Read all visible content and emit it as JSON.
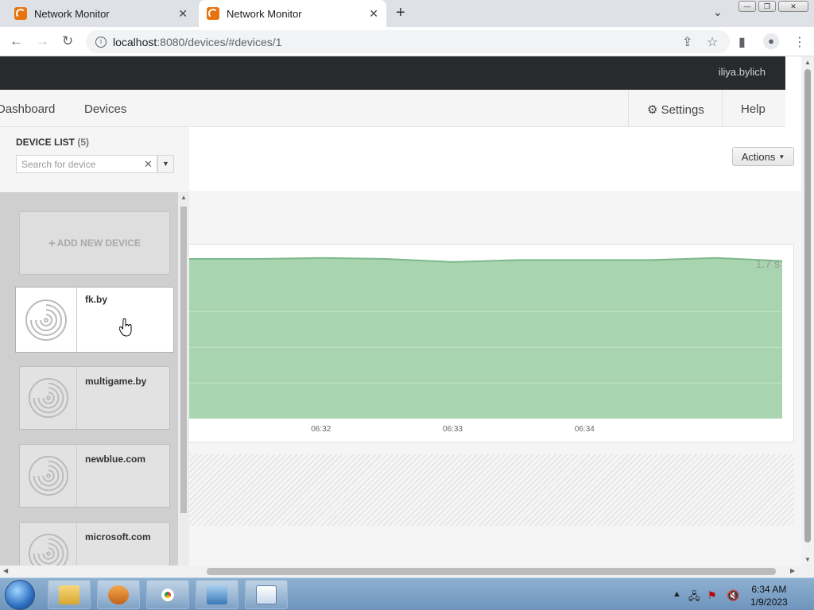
{
  "browser": {
    "tabs": [
      {
        "title": "Network Monitor"
      },
      {
        "title": "Network Monitor"
      }
    ],
    "url_host": "localhost",
    "url_path": ":8080/devices/#devices/1"
  },
  "header": {
    "user_image_alt": "iliya.bylich"
  },
  "nav": {
    "dashboard": "Dashboard",
    "devices": "Devices",
    "settings": "Settings",
    "help": "Help"
  },
  "sidebar": {
    "title": "DEVICE LIST",
    "count": "(5)",
    "search_placeholder": "Search for device",
    "add_new": "ADD NEW DEVICE",
    "devices": [
      {
        "name": "fk.by"
      },
      {
        "name": "multigame.by"
      },
      {
        "name": "newblue.com"
      },
      {
        "name": "microsoft.com"
      }
    ]
  },
  "main": {
    "actions_label": "Actions"
  },
  "chart_data": {
    "type": "area",
    "series": [
      {
        "values": [
          1.56,
          1.56,
          1.57,
          1.56,
          1.53,
          1.55,
          1.55,
          1.55,
          1.57,
          1.54
        ]
      }
    ],
    "x": [
      "",
      "",
      "06:32",
      "",
      "06:33",
      "",
      "06:34",
      "",
      "",
      ""
    ],
    "tick_labels": [
      "06:32",
      "06:33",
      "06:34"
    ],
    "ymax_label": "1.7 s",
    "ylim": [
      0,
      1.7
    ],
    "color": "#a8d5b0",
    "line_color": "#7cb88a"
  },
  "taskbar": {
    "time": "6:34 AM",
    "date": "1/9/2023"
  }
}
